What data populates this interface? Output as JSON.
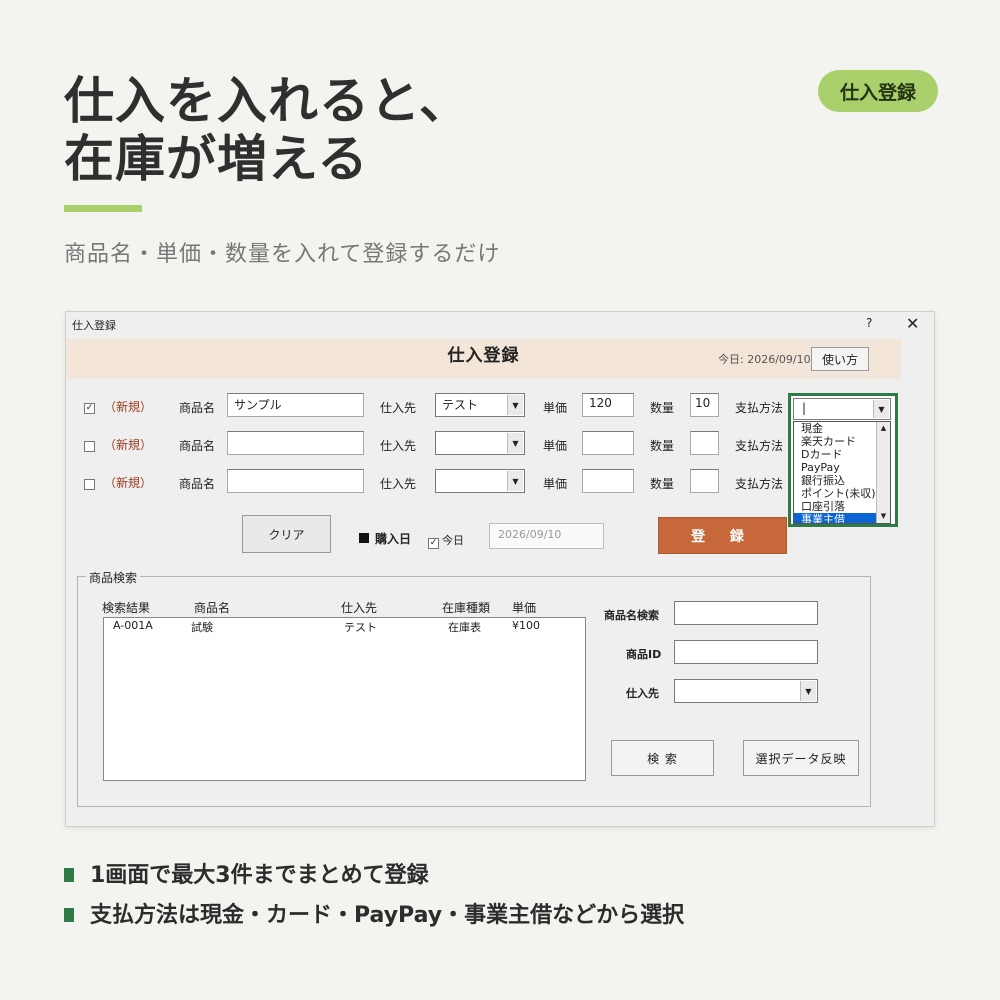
{
  "hero": {
    "title_line1": "仕入を入れると、",
    "title_line2": "在庫が増える",
    "subtitle": "商品名・単価・数量を入れて登録するだけ",
    "badge": "仕入登録"
  },
  "window": {
    "caption": "仕入登録",
    "help_glyph": "?",
    "close_glyph": "✕",
    "form_title": "仕入登録",
    "today_text": "今日: 2026/09/10",
    "howto_button": "使い方"
  },
  "labels": {
    "new": "（新規）",
    "product_name": "商品名",
    "supplier": "仕入先",
    "unit_price": "単価",
    "quantity": "数量",
    "payment_method": "支払方法"
  },
  "rows": [
    {
      "checked": true,
      "check_glyph": "✓",
      "product_name": "サンプル",
      "supplier": "テスト",
      "unit_price": "120",
      "quantity": "10"
    },
    {
      "checked": false,
      "check_glyph": "",
      "product_name": "",
      "supplier": "",
      "unit_price": "",
      "quantity": ""
    },
    {
      "checked": false,
      "check_glyph": "",
      "product_name": "",
      "supplier": "",
      "unit_price": "",
      "quantity": ""
    }
  ],
  "payment_dropdown": {
    "current_value": "|",
    "options": [
      "現金",
      "楽天カード",
      "Dカード",
      "PayPay",
      "銀行振込",
      "ポイント(未収)",
      "口座引落",
      "事業主借"
    ],
    "selected_option": "事業主借",
    "highlight_color": "#0a64d4"
  },
  "actions": {
    "clear_button": "クリア",
    "purchase_date_label": "購入日",
    "today_checkbox_glyph": "✓",
    "today_checkbox_label": "今日",
    "date_value": "2026/09/10",
    "register_button": "登 録",
    "register_color": "#c6683a"
  },
  "search": {
    "group_title": "商品検索",
    "columns": [
      "検索結果",
      "商品名",
      "仕入先",
      "在庫種類",
      "単価"
    ],
    "results": [
      {
        "id": "A-001A",
        "name": "試験",
        "supplier": "テスト",
        "stock_type": "在庫表",
        "price": "¥100"
      }
    ],
    "product_name_search_label": "商品名検索",
    "product_id_label": "商品ID",
    "supplier_label": "仕入先",
    "search_button": "検 索",
    "apply_button": "選択データ反映"
  },
  "bullets": [
    "1画面で最大3件までまとめて登録",
    "支払方法は現金・カード・PayPay・事業主借などから選択"
  ],
  "colors": {
    "accent_green": "#a9d06a",
    "dark_green": "#2e7b48",
    "header_band": "#f3e5d7"
  },
  "icons": {
    "dropdown": "chevron-down-icon",
    "checkbox": "check-icon",
    "square": "black-square-icon"
  }
}
